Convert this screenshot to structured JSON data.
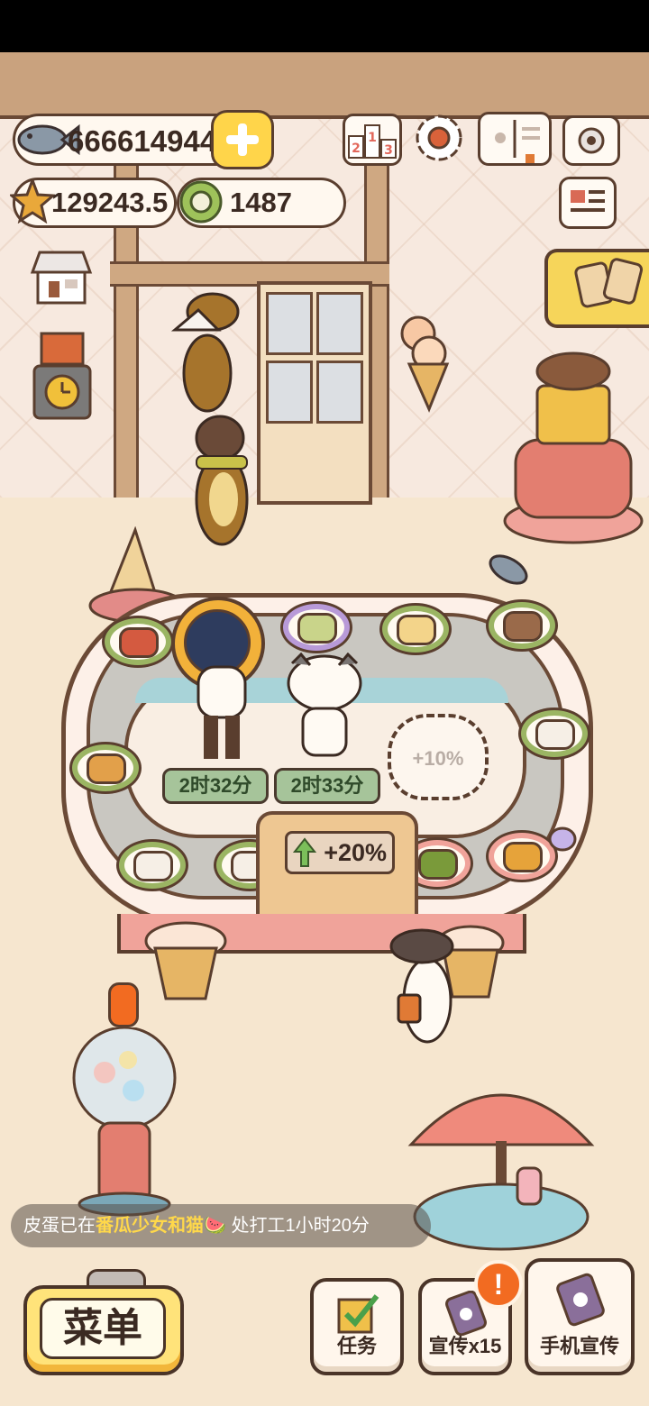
{
  "currency": {
    "fish_amount": "666614944",
    "stars_amount": "129243.5",
    "coins_amount": "1487"
  },
  "staff": [
    {
      "timer": "2时32分"
    },
    {
      "timer": "2时33分"
    }
  ],
  "slot_bonus": "+10%",
  "belt_bonus": "+20%",
  "notice": {
    "prefix": "皮蛋已在",
    "shop": "番瓜少女和猫",
    "watermelon": "🍉",
    "suffix": "处打工1小时20分"
  },
  "bottom_bar": {
    "menu_label": "菜单",
    "task_label": "任务",
    "promo_label": "宣传x15",
    "promo_badge": "!",
    "phone_promo_label": "手机宣传"
  },
  "colors": {
    "accent_yellow": "#ffe37a",
    "badge_orange": "#f26b21",
    "timer_green": "#a6c49a"
  }
}
